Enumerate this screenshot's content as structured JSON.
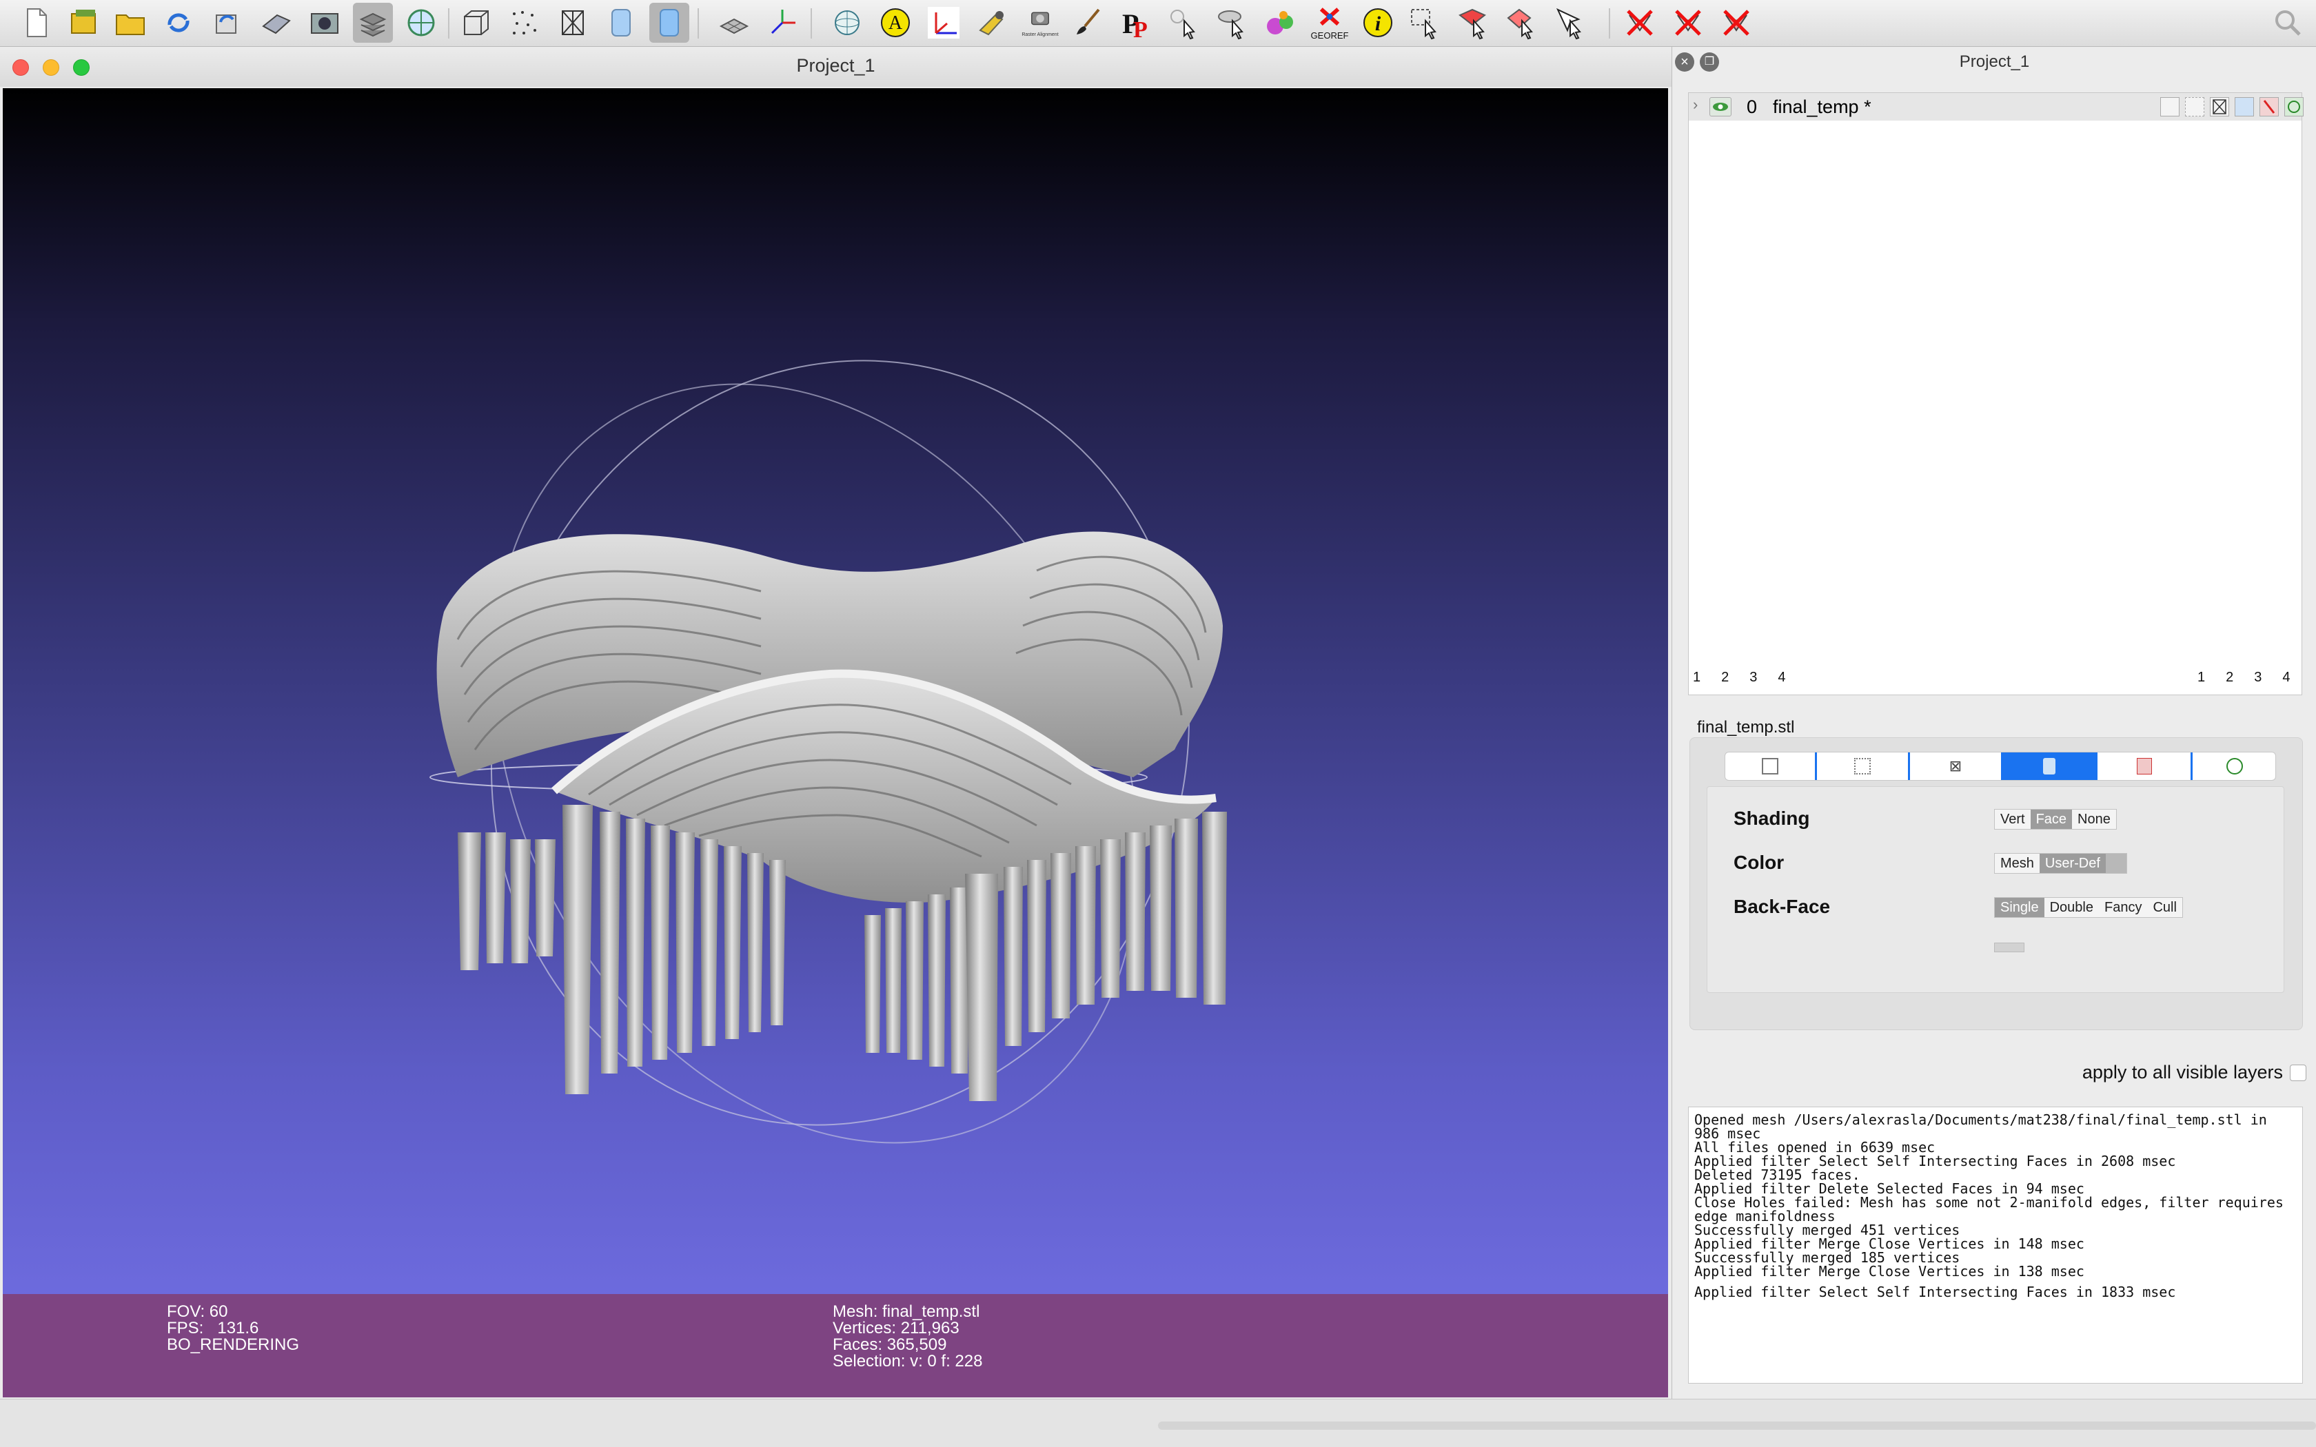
{
  "toolbar": {
    "icons": [
      "new-file-icon",
      "open-project-icon",
      "open-folder-icon",
      "reload-icon",
      "reload-all-icon",
      "save-icon",
      "snapshot-icon",
      "layers-icon",
      "globe-view-icon",
      "bounding-box-icon",
      "points-icon",
      "wireframe-icon",
      "flat-shading-icon",
      "smooth-shading-icon",
      "grid-icon",
      "axis-icon",
      "sphere-view-icon",
      "annotate-icon",
      "coordinate-frame-icon",
      "measure-icon",
      "raster-alignment-icon",
      "paint-brush-icon",
      "p-tool-icon",
      "select-vertex-icon",
      "select-tool-icon",
      "pickpoints-icon",
      "isoparam-icon",
      "georef-icon",
      "info-icon",
      "select-area-icon",
      "select-faces-icon",
      "select-connected-icon",
      "select-pointer-icon",
      "delete-faces-icon",
      "delete-vertices-icon",
      "delete-all-icon",
      "search-icon"
    ],
    "raster_label": "Raster Alignment",
    "georef_label": "GEOREF"
  },
  "viewer": {
    "title": "Project_1",
    "info_left": [
      "FOV: 60",
      "FPS:   131.6",
      "BO_RENDERING"
    ],
    "info_right": [
      "Mesh: final_temp.stl",
      "Vertices: 211,963",
      "Faces: 365,509",
      "Selection: v: 0 f: 228"
    ]
  },
  "panel": {
    "title": "Project_1",
    "layer": {
      "index": "0",
      "name": "final_temp *"
    },
    "pages_left": [
      "1",
      "2",
      "3",
      "4"
    ],
    "pages_right": [
      "1",
      "2",
      "3",
      "4"
    ],
    "mesh_name": "final_temp.stl",
    "shading": {
      "label": "Shading",
      "options": [
        "Vert",
        "Face",
        "None"
      ],
      "selected": "Face"
    },
    "color": {
      "label": "Color",
      "options": [
        "Mesh",
        "User-Def"
      ],
      "selected": "User-Def"
    },
    "backface": {
      "label": "Back-Face",
      "options": [
        "Single",
        "Double",
        "Fancy",
        "Cull"
      ],
      "selected": "Single"
    },
    "apply_all": "apply to all visible layers"
  },
  "log": [
    "Opened mesh /Users/alexrasla/Documents/mat238/final/final_temp.stl in 986 msec",
    "All files opened in 6639 msec",
    "Applied filter Select Self Intersecting Faces in 2608 msec",
    "Deleted 73195 faces.",
    "Applied filter Delete Selected Faces in 94 msec",
    "Close Holes failed: Mesh has some not 2-manifold edges, filter requires edge manifoldness",
    "Successfully merged 451 vertices",
    "Applied filter Merge Close Vertices in 148 msec",
    "Successfully merged 185 vertices",
    "Applied filter Merge Close Vertices in 138 msec",
    "",
    "Applied filter Select Self Intersecting Faces in 1833 msec"
  ]
}
